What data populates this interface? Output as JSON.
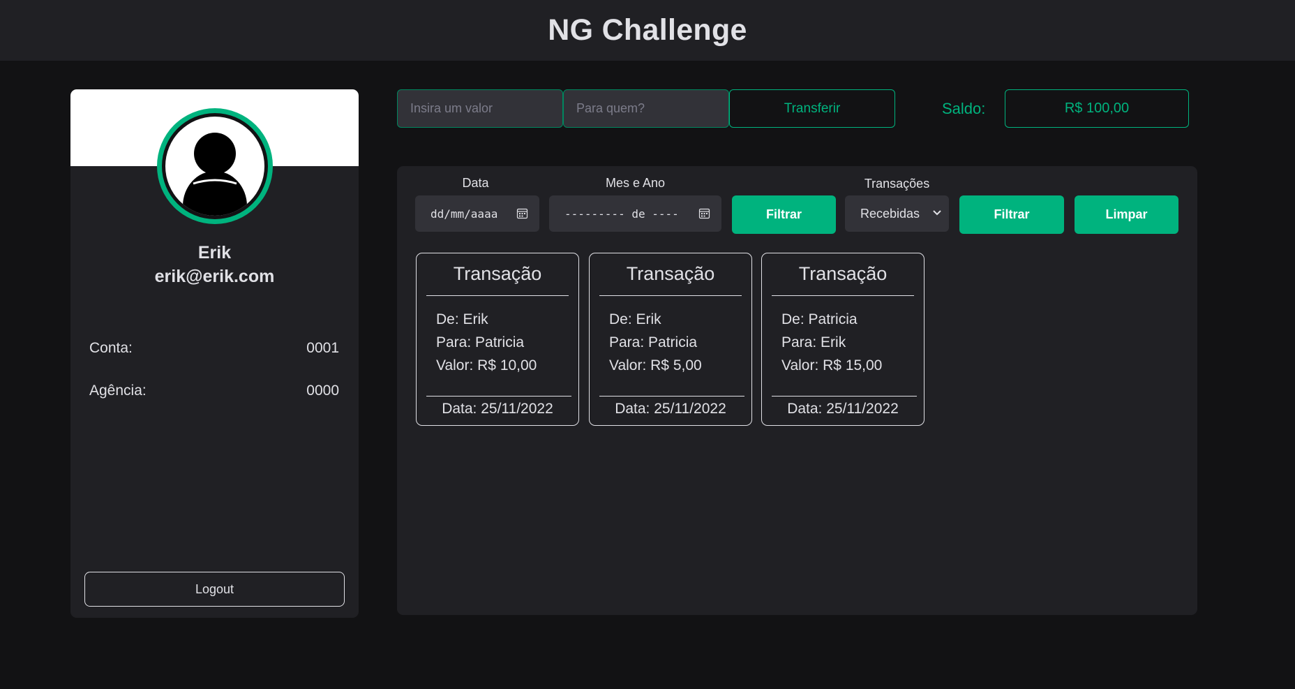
{
  "header": {
    "title": "NG Challenge"
  },
  "profile": {
    "name": "Erik",
    "email": "erik@erik.com",
    "account_label": "Conta:",
    "account_value": "0001",
    "agency_label": "Agência:",
    "agency_value": "0000",
    "logout_label": "Logout"
  },
  "transfer": {
    "amount_placeholder": "Insira um valor",
    "recipient_placeholder": "Para quem?",
    "button_label": "Transferir",
    "balance_label": "Saldo:",
    "balance_value": "R$ 100,00"
  },
  "filters": {
    "date_label": "Data",
    "date_placeholder": "dd/mm/aaaa",
    "month_label": "Mes e Ano",
    "month_placeholder": "--------- de ----",
    "filter_button": "Filtrar",
    "type_label": "Transações",
    "type_selected": "Recebidas",
    "filter_button_2": "Filtrar",
    "clear_button": "Limpar"
  },
  "transactions": [
    {
      "title": "Transação",
      "from": "De: Erik",
      "to": "Para: Patricia",
      "value": "Valor: R$ 10,00",
      "date": "Data: 25/11/2022"
    },
    {
      "title": "Transação",
      "from": "De: Erik",
      "to": "Para: Patricia",
      "value": "Valor: R$ 5,00",
      "date": "Data: 25/11/2022"
    },
    {
      "title": "Transação",
      "from": "De: Patricia",
      "to": "Para: Erik",
      "value": "Valor: R$ 15,00",
      "date": "Data: 25/11/2022"
    }
  ],
  "colors": {
    "accent": "#00b37e",
    "background": "#121214",
    "surface": "#202024",
    "input": "#323238",
    "text": "#e1e1e6"
  },
  "icons": {
    "avatar": "user-silhouette-icon",
    "calendar": "calendar-icon",
    "select": "chevron-down-icon"
  }
}
